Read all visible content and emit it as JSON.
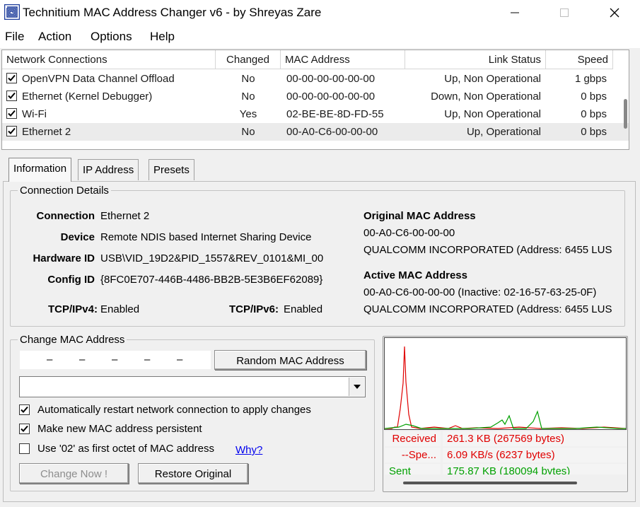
{
  "window": {
    "title": "Technitium MAC Address Changer v6 - by Shreyas Zare"
  },
  "menu": [
    "File",
    "Action",
    "Options",
    "Help"
  ],
  "connections": {
    "columns": [
      "Network Connections",
      "Changed",
      "MAC Address",
      "Link Status",
      "Speed"
    ],
    "rows": [
      {
        "checked": true,
        "name": "OpenVPN Data Channel Offload",
        "changed": "No",
        "mac": "00-00-00-00-00-00",
        "status": "Up, Non Operational",
        "speed": "1 gbps"
      },
      {
        "checked": true,
        "name": "Ethernet (Kernel Debugger)",
        "changed": "No",
        "mac": "00-00-00-00-00-00",
        "status": "Down, Non Operational",
        "speed": "0 bps"
      },
      {
        "checked": true,
        "name": "Wi-Fi",
        "changed": "Yes",
        "mac": "02-BE-BE-8D-FD-55",
        "status": "Up, Non Operational",
        "speed": "0 bps"
      },
      {
        "checked": true,
        "name": "Ethernet 2",
        "changed": "No",
        "mac": "00-A0-C6-00-00-00",
        "status": "Up, Operational",
        "speed": "0 bps",
        "selected": true
      }
    ]
  },
  "tabs": [
    "Information",
    "IP Address",
    "Presets"
  ],
  "details": {
    "group_title": "Connection Details",
    "connection_label": "Connection",
    "connection": "Ethernet 2",
    "device_label": "Device",
    "device": "Remote NDIS based Internet Sharing Device",
    "hardware_id_label": "Hardware ID",
    "hardware_id": "USB\\VID_19D2&PID_1557&REV_0101&MI_00",
    "config_id_label": "Config ID",
    "config_id": "{8FC0E707-446B-4486-BB2B-5E3B6EF62089}",
    "tcpv4_label": "TCP/IPv4:",
    "tcpv4": "Enabled",
    "tcpv6_label": "TCP/IPv6:",
    "tcpv6": "Enabled",
    "original_mac_label": "Original MAC Address",
    "original_mac": "00-A0-C6-00-00-00",
    "original_vendor": "QUALCOMM INCORPORATED  (Address: 6455 LUS",
    "active_mac_label": "Active MAC Address",
    "active_mac": "00-A0-C6-00-00-00 (Inactive: 02-16-57-63-25-0F)",
    "active_vendor": "QUALCOMM INCORPORATED  (Address: 6455 LUS"
  },
  "change_mac": {
    "group_title": "Change MAC Address",
    "octets": [
      "–",
      "–",
      "–",
      "–",
      "–"
    ],
    "random_button": "Random MAC Address",
    "combo_value": "",
    "auto_restart_label": "Automatically restart network connection to apply changes",
    "auto_restart_checked": true,
    "persistent_label": "Make new MAC address persistent",
    "persistent_checked": true,
    "use02_label": "Use '02' as first octet of MAC address",
    "use02_checked": false,
    "why_link": "Why?",
    "change_now_button": "Change Now !",
    "restore_button": "Restore Original"
  },
  "stats": {
    "received_label": "Received",
    "received_value": "261.3 KB (267569 bytes)",
    "recv_speed_label": "--Spe...",
    "recv_speed_value": "6.09 KB/s (6237 bytes)",
    "sent_label": "Sent",
    "sent_value": "175.87 KB (180094 bytes)"
  },
  "colors": {
    "received": "#e00000",
    "sent": "#00a000",
    "stat_bg": "#f4f4f4"
  }
}
